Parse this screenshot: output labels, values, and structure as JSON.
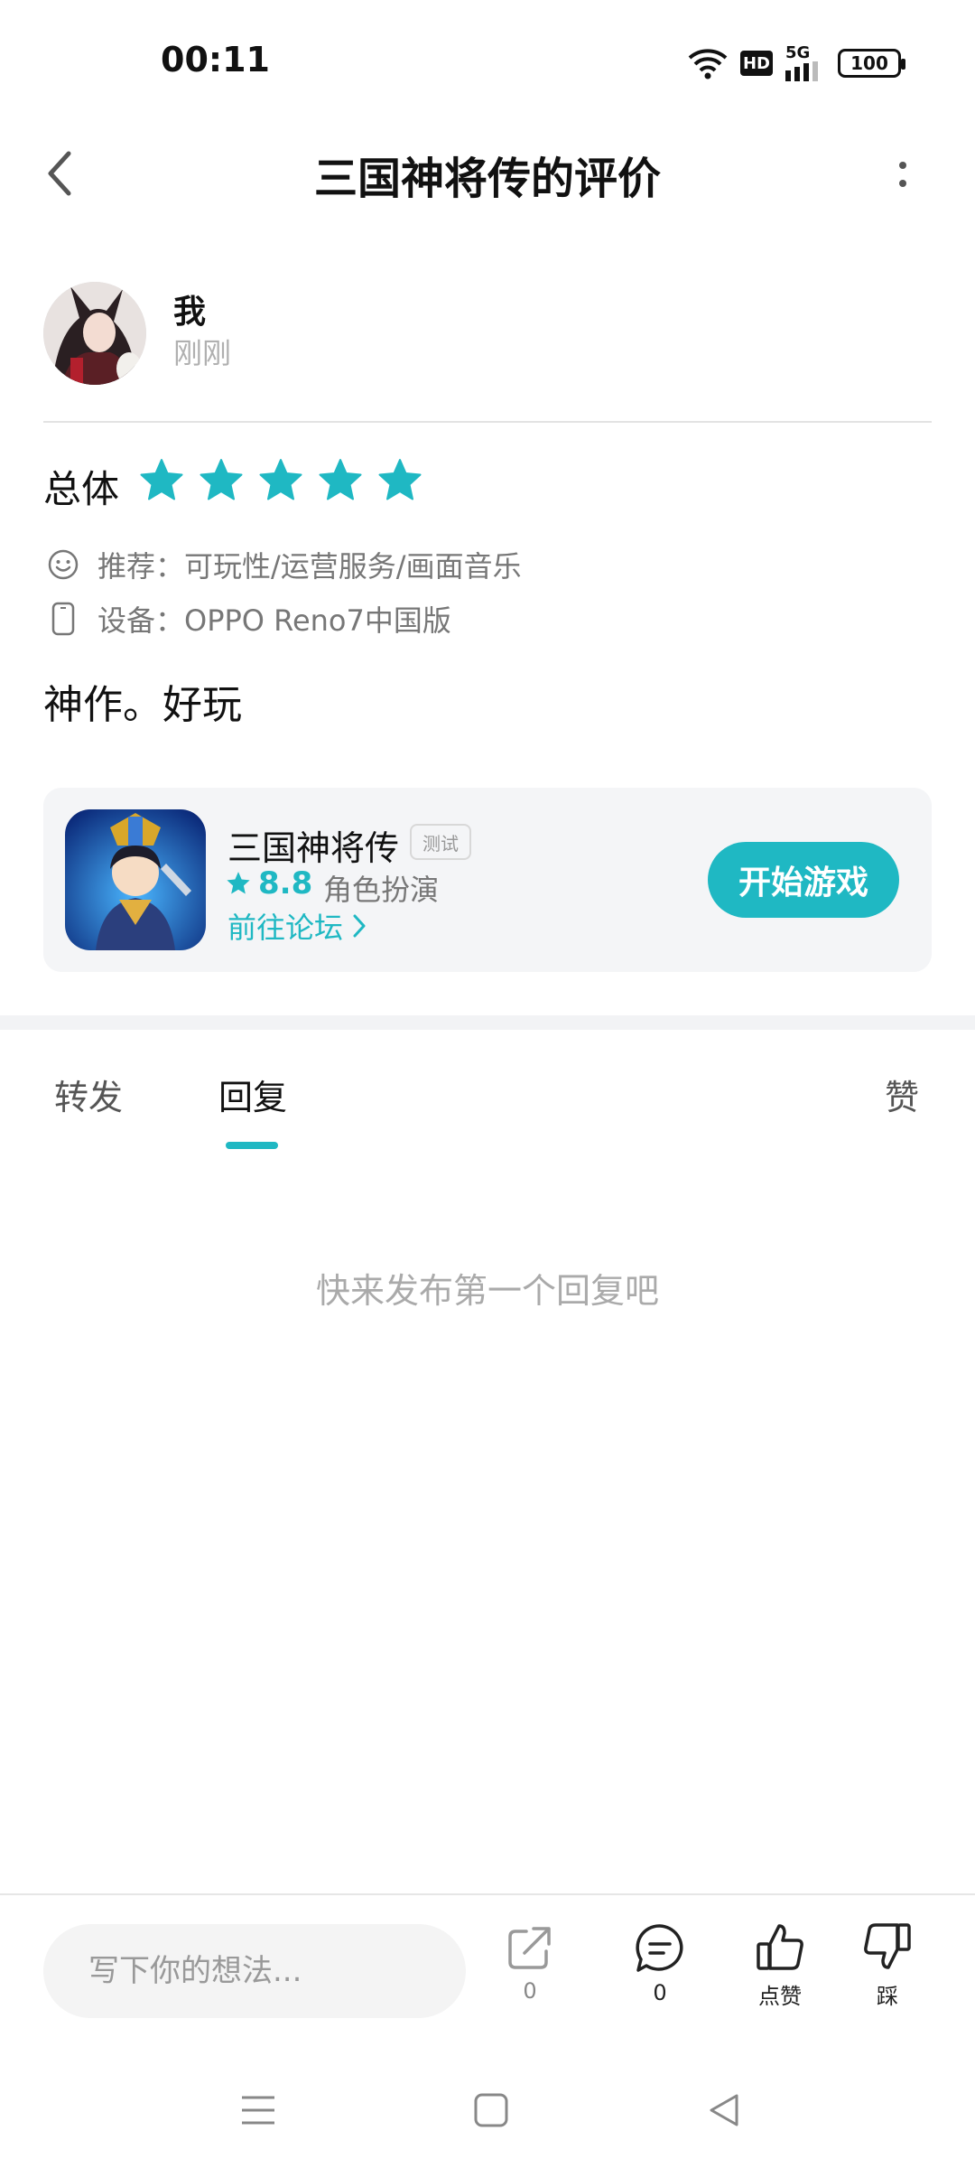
{
  "status_bar": {
    "time": "00:11",
    "hd": "HD",
    "network": "5G",
    "battery": "100"
  },
  "header": {
    "title": "三国神将传的评价"
  },
  "user": {
    "name": "我",
    "time": "刚刚"
  },
  "rating": {
    "label": "总体",
    "stars": 5,
    "star_color": "#1fb8c3"
  },
  "meta": {
    "recommend_label": "推荐：",
    "recommend_value": "可玩性/运营服务/画面音乐",
    "device_label": "设备：",
    "device_value": "OPPO Reno7中国版"
  },
  "review": {
    "text": "神作。好玩"
  },
  "game": {
    "name": "三国神将传",
    "tag": "测试",
    "score": "8.8",
    "genre": "角色扮演",
    "forum_link": "前往论坛",
    "play_button": "开始游戏"
  },
  "tabs": {
    "forward": "转发",
    "reply": "回复",
    "like": "赞",
    "active": "reply"
  },
  "empty_state": {
    "text": "快来发布第一个回复吧"
  },
  "bottom_bar": {
    "input_placeholder": "写下你的想法...",
    "share_count": "0",
    "comment_count": "0",
    "like_label": "点赞",
    "dislike_label": "踩"
  },
  "colors": {
    "accent": "#1fb8c3",
    "card_bg": "#f4f5f7"
  }
}
